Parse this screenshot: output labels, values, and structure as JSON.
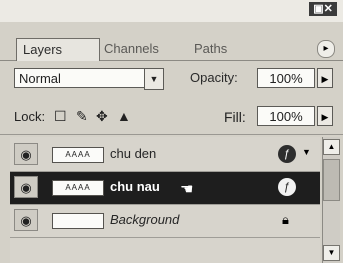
{
  "window": {
    "close_glyph": "▣✕"
  },
  "tabs": [
    {
      "label": "Layers"
    },
    {
      "label": "Channels"
    },
    {
      "label": "Paths"
    }
  ],
  "tab_menu_glyph": "▸",
  "blend": {
    "mode": "Normal",
    "dropdown_glyph": "▼"
  },
  "opacity": {
    "label": "Opacity:",
    "value": "100%",
    "arrow_glyph": "▶"
  },
  "lock": {
    "label": "Lock:"
  },
  "fill": {
    "label": "Fill:",
    "value": "100%",
    "arrow_glyph": "▶"
  },
  "layers": [
    {
      "name": "chu den",
      "thumb_text": "AAAA",
      "selected": false
    },
    {
      "name": "chu nau",
      "thumb_text": "AAAA",
      "selected": true
    },
    {
      "name": "Background",
      "thumb_text": "",
      "selected": false
    }
  ],
  "scrollbar": {
    "up_glyph": "▲",
    "down_glyph": "▼"
  }
}
